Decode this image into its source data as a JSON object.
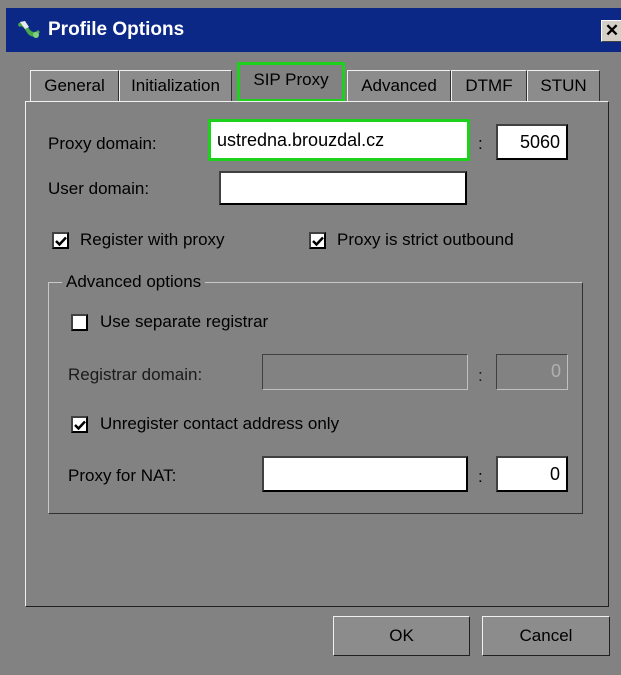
{
  "window": {
    "title": "Profile Options"
  },
  "tabs": [
    {
      "label": "General"
    },
    {
      "label": "Initialization"
    },
    {
      "label": "SIP Proxy"
    },
    {
      "label": "Advanced"
    },
    {
      "label": "DTMF"
    },
    {
      "label": "STUN"
    }
  ],
  "active_tab": "SIP Proxy",
  "proxy": {
    "domain_label": "Proxy domain:",
    "domain_value": "ustredna.brouzdal.cz",
    "port_value": "5060",
    "colon": ":",
    "user_domain_label": "User domain:",
    "user_domain_value": ""
  },
  "checks": {
    "register_label": "Register with proxy",
    "register_checked": true,
    "strict_label": "Proxy is strict outbound",
    "strict_checked": true
  },
  "advanced": {
    "title": "Advanced options",
    "separate_registrar_label": "Use separate registrar",
    "separate_registrar_checked": false,
    "registrar_domain_label": "Registrar domain:",
    "registrar_domain_value": "",
    "registrar_port_value": "0",
    "unregister_label": "Unregister contact address only",
    "unregister_checked": true,
    "nat_label": "Proxy for NAT:",
    "nat_value": "",
    "nat_port_value": "0"
  },
  "buttons": {
    "ok": "OK",
    "cancel": "Cancel"
  },
  "colors": {
    "titlebar": "#0c2886",
    "dialog": "#828282",
    "highlight": "#1cd21c"
  }
}
